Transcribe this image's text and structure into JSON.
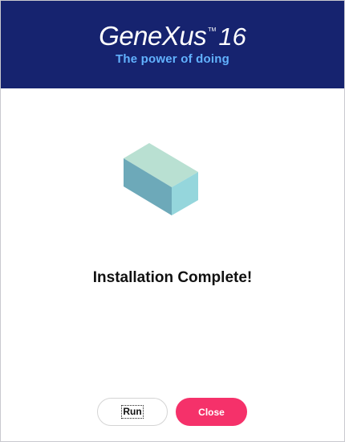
{
  "colors": {
    "brand": "#16236f",
    "accent": "#62b2ff",
    "action": "#f5316a"
  },
  "header": {
    "product_name": "GeneXus",
    "trademark": "TM",
    "version": "16",
    "tagline": "The power of doing"
  },
  "illustration": {
    "icon": "package-box-icon"
  },
  "main": {
    "status_message": "Installation Complete!"
  },
  "actions": {
    "run_label": "Run",
    "close_label": "Close"
  }
}
